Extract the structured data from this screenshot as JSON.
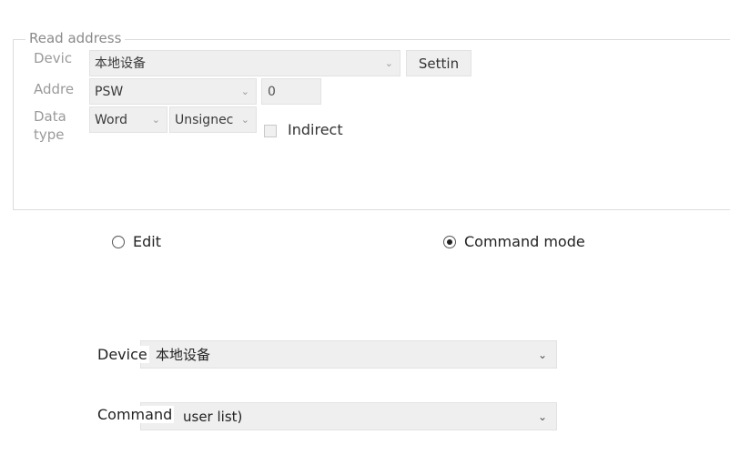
{
  "read_address": {
    "legend": "Read address",
    "device_label": "Devic",
    "device_value": "本地设备",
    "settings_button": "Settin",
    "address_label": "Addre",
    "address_value": "PSW",
    "offset_value": "0",
    "data_type_label_line1": "Data",
    "data_type_label_line2": "type",
    "word_value": "Word",
    "unsigned_value": "Unsignec",
    "indirect_label": "Indirect"
  },
  "mode": {
    "edit_label": "Edit",
    "command_mode_label": "Command mode",
    "selected": "command"
  },
  "bottom": {
    "device_label": "Device",
    "device_value": "本地设备",
    "command_label": "Command",
    "command_value": "user list)"
  }
}
